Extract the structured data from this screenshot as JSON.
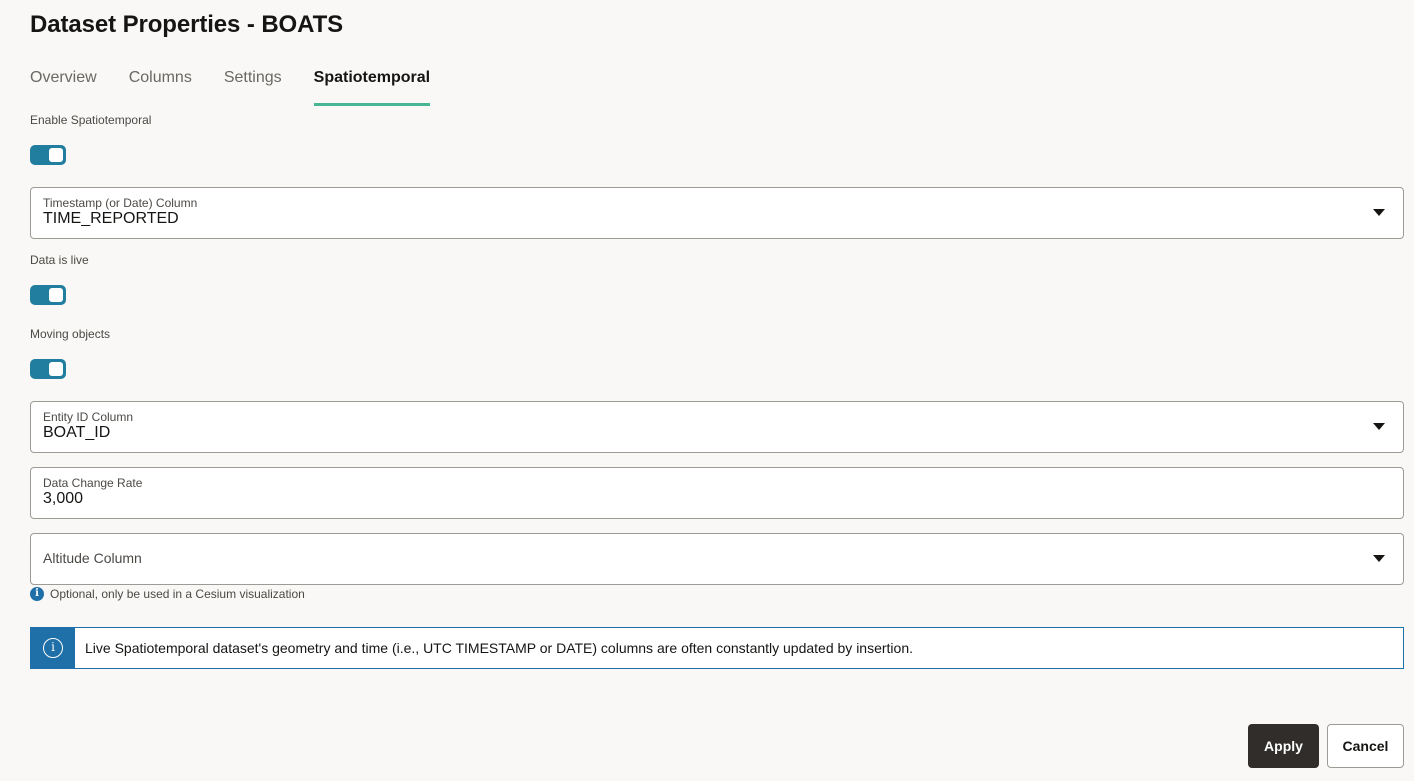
{
  "dialog": {
    "title": "Dataset Properties - BOATS"
  },
  "tabs": [
    {
      "label": "Overview",
      "active": false
    },
    {
      "label": "Columns",
      "active": false
    },
    {
      "label": "Settings",
      "active": false
    },
    {
      "label": "Spatiotemporal",
      "active": true
    }
  ],
  "form": {
    "enable_spatiotemporal": {
      "label": "Enable Spatiotemporal",
      "on": true
    },
    "timestamp_column": {
      "label": "Timestamp (or Date) Column",
      "value": "TIME_REPORTED"
    },
    "data_is_live": {
      "label": "Data is live",
      "on": true
    },
    "moving_objects": {
      "label": "Moving objects",
      "on": true
    },
    "entity_id_column": {
      "label": "Entity ID Column",
      "value": "BOAT_ID"
    },
    "data_change_rate": {
      "label": "Data Change Rate",
      "value": "3,000"
    },
    "altitude_column": {
      "placeholder": "Altitude Column",
      "hint": "Optional, only be used in a Cesium visualization"
    }
  },
  "banner": {
    "text": "Live Spatiotemporal dataset's geometry and time (i.e., UTC TIMESTAMP or DATE) columns are often constantly updated by insertion."
  },
  "buttons": {
    "apply": "Apply",
    "cancel": "Cancel"
  },
  "colors": {
    "accent_tab": "#48b594",
    "toggle_on": "#227e9e",
    "info": "#1f6fa8",
    "primary_button": "#312d2a"
  }
}
